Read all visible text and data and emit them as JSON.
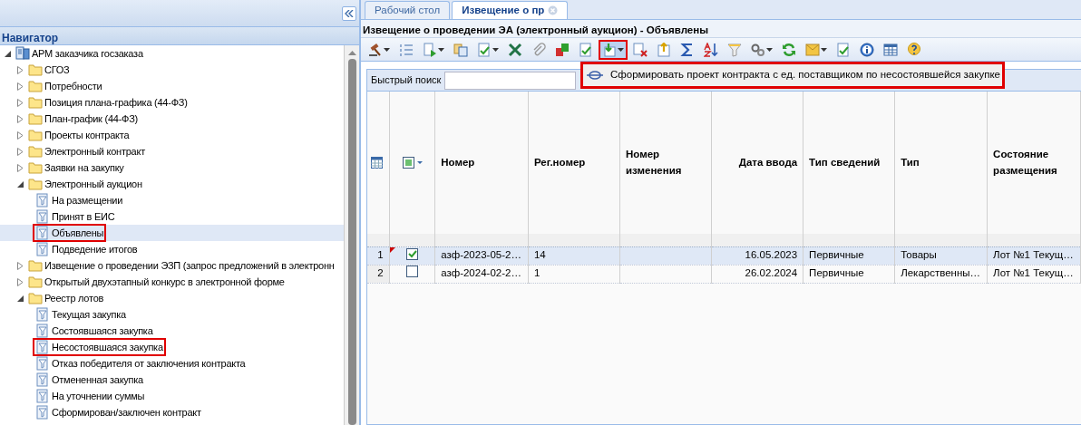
{
  "navigator": {
    "title": "Навигатор",
    "tree": [
      {
        "label": "АРМ заказчика госзаказа",
        "kind": "root",
        "expanded": true,
        "selected": false,
        "highlighted": false,
        "children": [
          {
            "label": "СГОЗ",
            "kind": "folder",
            "expanded": false,
            "selected": false,
            "highlighted": false
          },
          {
            "label": "Потребности",
            "kind": "folder",
            "expanded": false,
            "selected": false,
            "highlighted": false
          },
          {
            "label": "Позиция плана-графика (44-ФЗ)",
            "kind": "folder",
            "expanded": false,
            "selected": false,
            "highlighted": false
          },
          {
            "label": "План-график (44-ФЗ)",
            "kind": "folder",
            "expanded": false,
            "selected": false,
            "highlighted": false
          },
          {
            "label": "Проекты контракта",
            "kind": "folder",
            "expanded": false,
            "selected": false,
            "highlighted": false
          },
          {
            "label": "Электронный контракт",
            "kind": "folder",
            "expanded": false,
            "selected": false,
            "highlighted": false
          },
          {
            "label": "Заявки на закупку",
            "kind": "folder",
            "expanded": false,
            "selected": false,
            "highlighted": false
          },
          {
            "label": "Электронный аукцион",
            "kind": "folder",
            "expanded": true,
            "selected": false,
            "highlighted": false,
            "children": [
              {
                "label": "На размещении",
                "kind": "filter",
                "selected": false,
                "highlighted": false
              },
              {
                "label": "Принят в ЕИС",
                "kind": "filter",
                "selected": false,
                "highlighted": false
              },
              {
                "label": "Объявлены",
                "kind": "filter",
                "selected": true,
                "highlighted": true
              },
              {
                "label": "Подведение итогов",
                "kind": "filter",
                "selected": false,
                "highlighted": false
              }
            ]
          },
          {
            "label": "Извещение о проведении ЭЗП (запрос предложений в электронн",
            "kind": "folder",
            "expanded": false,
            "selected": false,
            "highlighted": false
          },
          {
            "label": "Открытый двухэтапный конкурс в электронной форме",
            "kind": "folder",
            "expanded": false,
            "selected": false,
            "highlighted": false
          },
          {
            "label": "Реестр лотов",
            "kind": "folder",
            "expanded": true,
            "selected": false,
            "highlighted": false,
            "children": [
              {
                "label": "Текущая закупка",
                "kind": "filter",
                "selected": false,
                "highlighted": false
              },
              {
                "label": "Состоявшаяся закупка",
                "kind": "filter",
                "selected": false,
                "highlighted": false
              },
              {
                "label": "Несостоявшаяся закупка",
                "kind": "filter",
                "selected": false,
                "highlighted": true
              },
              {
                "label": "Отказ победителя от заключения контракта",
                "kind": "filter",
                "selected": false,
                "highlighted": false
              },
              {
                "label": "Отмененная закупка",
                "kind": "filter",
                "selected": false,
                "highlighted": false
              },
              {
                "label": "На уточнении суммы",
                "kind": "filter",
                "selected": false,
                "highlighted": false
              },
              {
                "label": "Сформирован/заключен контракт",
                "kind": "filter",
                "selected": false,
                "highlighted": false
              }
            ]
          }
        ]
      }
    ]
  },
  "tabs": [
    {
      "label": "Рабочий стол",
      "selected": false,
      "closable": false
    },
    {
      "label": "Извещение о пр",
      "selected": true,
      "closable": true
    }
  ],
  "page_title": "Извещение о проведении ЭА (электронный аукцион) - Объявлены",
  "toolbar": [
    {
      "kind": "gavel",
      "dropdown": true,
      "highlighted": false
    },
    {
      "kind": "list",
      "dropdown": false,
      "highlighted": false
    },
    {
      "kind": "doc-play",
      "dropdown": true,
      "highlighted": false
    },
    {
      "kind": "copy",
      "dropdown": false,
      "highlighted": false
    },
    {
      "kind": "doc-check",
      "dropdown": true,
      "highlighted": false
    },
    {
      "kind": "excel",
      "dropdown": false,
      "highlighted": false
    },
    {
      "kind": "clip",
      "dropdown": false,
      "highlighted": false
    },
    {
      "kind": "squares",
      "dropdown": false,
      "highlighted": false
    },
    {
      "kind": "doc-check",
      "dropdown": false,
      "highlighted": false
    },
    {
      "kind": "doc-down",
      "dropdown": true,
      "highlighted": true
    },
    {
      "kind": "doc-delete",
      "dropdown": false,
      "highlighted": false
    },
    {
      "kind": "doc-up",
      "dropdown": false,
      "highlighted": false
    },
    {
      "kind": "sigma",
      "dropdown": false,
      "highlighted": false
    },
    {
      "kind": "sort",
      "dropdown": false,
      "highlighted": false
    },
    {
      "kind": "filter",
      "dropdown": false,
      "highlighted": false
    },
    {
      "kind": "gears",
      "dropdown": true,
      "highlighted": false
    },
    {
      "kind": "refresh",
      "dropdown": false,
      "highlighted": false
    },
    {
      "kind": "mail",
      "dropdown": true,
      "highlighted": false
    },
    {
      "kind": "doc-check",
      "dropdown": false,
      "highlighted": false
    },
    {
      "kind": "info",
      "dropdown": false,
      "highlighted": false
    },
    {
      "kind": "table",
      "dropdown": false,
      "highlighted": false
    },
    {
      "kind": "help",
      "dropdown": false,
      "highlighted": false
    }
  ],
  "dropdown_menu": {
    "items": [
      {
        "label": "Сформировать проект контракта с ед. поставщиком по несостоявшейся закупке",
        "highlighted": true
      }
    ]
  },
  "quick_search": {
    "label": "Быстрый поиск"
  },
  "grid": {
    "select_all": {
      "indeterminate": true
    },
    "columns": [
      {
        "label": "Номер",
        "kind": "text"
      },
      {
        "label": "Рег.номер",
        "kind": "text"
      },
      {
        "label": "Номер изменения",
        "kind": "text"
      },
      {
        "label": "Дата ввода",
        "kind": "date"
      },
      {
        "label": "Тип сведений",
        "kind": "text"
      },
      {
        "label": "Тип",
        "kind": "text"
      },
      {
        "label": "Состояние размещения",
        "kind": "text"
      }
    ],
    "rows": [
      {
        "number": "1",
        "checked": true,
        "selected": true,
        "modified": true,
        "cells": [
          "азф-2023-05-2…",
          "14",
          "",
          "16.05.2023",
          "Первичные",
          "Товары",
          "Лот №1 Текущ…"
        ]
      },
      {
        "number": "2",
        "checked": false,
        "selected": false,
        "modified": false,
        "cells": [
          "азф-2024-02-2…",
          "1",
          "",
          "26.02.2024",
          "Первичные",
          "Лекарственны…",
          "Лот №1 Текущ…"
        ]
      }
    ]
  }
}
